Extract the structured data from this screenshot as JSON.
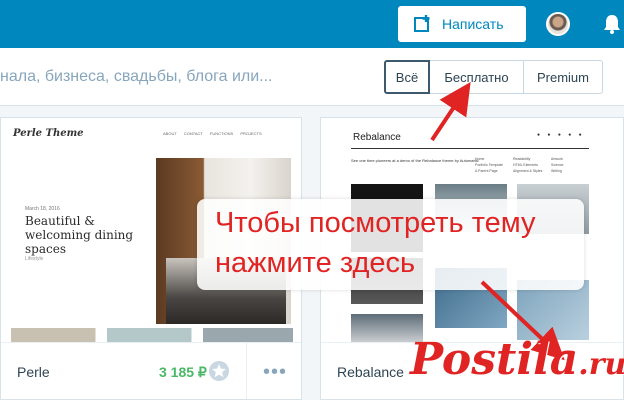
{
  "topbar": {
    "write_label": "Написать",
    "accent": "#0087be"
  },
  "search": {
    "placeholder_fragment": "нала, бизнеса, свадьбы, блога или..."
  },
  "filters": [
    {
      "label": "Всё",
      "active": true
    },
    {
      "label": "Бесплатно",
      "active": false
    },
    {
      "label": "Premium",
      "active": false
    }
  ],
  "themes": [
    {
      "name": "Perle",
      "price": "3 185 ₽",
      "preview": {
        "logo": "Perle Theme",
        "nav": "ABOUT CONTACT FUNCTIONS PROJECTS",
        "date": "March 18, 2016",
        "headline": "Beautiful & welcoming dining spaces",
        "tag": "Lifestyle"
      }
    },
    {
      "name": "Rebalance",
      "preview": {
        "logo": "Rebalance",
        "tagline": "See one time pioneers at a demo of the Rebalance theme by Automattic",
        "menu_col1": [
          "Home",
          "Portfolio Template",
          "A Parent Page"
        ],
        "menu_col2": [
          "Readability",
          "HTML Elements",
          "Alignment & Styles"
        ],
        "menu_col3": [
          "Artwork",
          "Science",
          "Writing"
        ]
      }
    }
  ],
  "annotation": {
    "line1": "Чтобы посмотреть тему",
    "line2": "нажмите здесь",
    "color": "#e02424"
  },
  "watermark": {
    "text": "Postila",
    "suffix": ".ru"
  }
}
